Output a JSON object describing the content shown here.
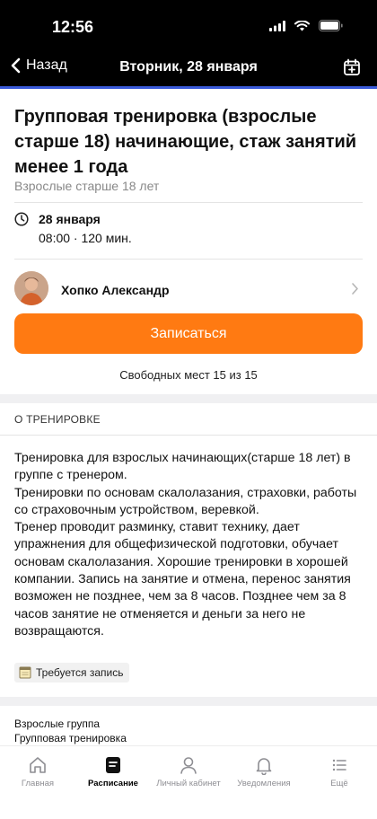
{
  "status_bar": {
    "time": "12:56"
  },
  "nav": {
    "back_label": "Назад",
    "title": "Вторник, 28 января",
    "calendar_icon": "calendar-add-icon"
  },
  "event": {
    "title": "Групповая тренировка (взрослые старше 18) начинающие, стаж занятий  менее 1 года",
    "subtitle": "Взрослые старше 18 лет",
    "date": "28 января",
    "time": "08:00 · 120 мин."
  },
  "coach": {
    "name": "Хопко Александр"
  },
  "signup": {
    "button_label": "Записаться",
    "free_spots": "Свободных мест 15 из 15"
  },
  "about": {
    "heading": "О ТРЕНИРОВКЕ",
    "text": "Тренировка для взрослых начинающих(старше 18 лет) в группе с тренером.\nТренировки по основам скалолазания, страховки, работы со страховочным устройством, веревкой.\nТренер проводит разминку, ставит технику, дает упражнения для общефизической подготовки, обучает основам скалолазания. Хорошие тренировки в хорошей компании. Запись на занятие и отмена, перенос занятия возможен не позднее, чем за 8 часов. Позднее чем за 8 часов занятие не отменяется и деньги за него не возвращаются.",
    "badge": "Требуется запись"
  },
  "categories": {
    "group": "Взрослые группа",
    "type": "Групповая тренировка"
  },
  "tabs": [
    {
      "label": "Главная",
      "icon": "home-icon"
    },
    {
      "label": "Расписание",
      "icon": "schedule-icon",
      "active": true
    },
    {
      "label": "Личный кабинет",
      "icon": "person-icon"
    },
    {
      "label": "Уведомления",
      "icon": "bell-icon"
    },
    {
      "label": "Ещё",
      "icon": "more-icon"
    }
  ],
  "colors": {
    "accent": "#ff7a12",
    "nav_underline": "#3b5bdb"
  }
}
